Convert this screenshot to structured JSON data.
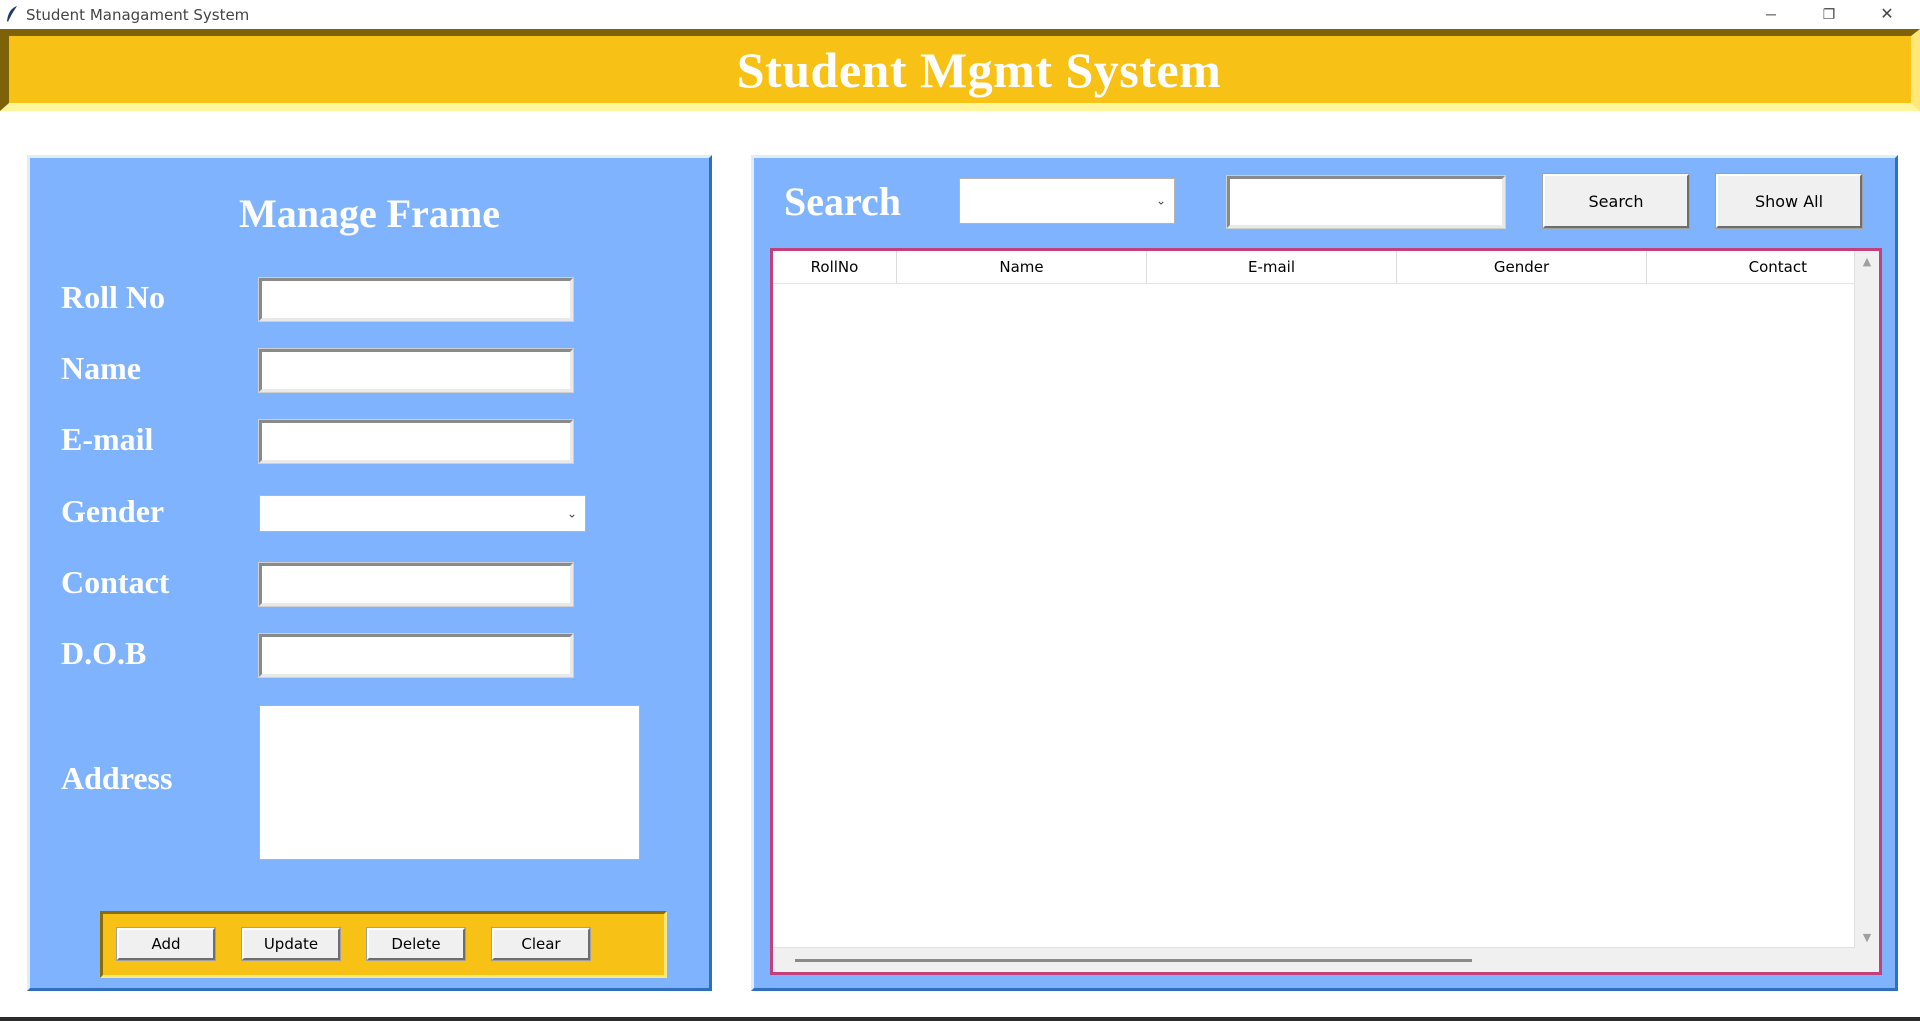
{
  "window": {
    "title": "Student Managament System",
    "controls": {
      "minimize": "─",
      "restore": "❐",
      "close": "✕"
    }
  },
  "header": {
    "title": "Student Mgmt System"
  },
  "manage": {
    "title": "Manage Frame",
    "fields": {
      "roll": {
        "label": "Roll No",
        "value": ""
      },
      "name": {
        "label": "Name",
        "value": ""
      },
      "email": {
        "label": "E-mail",
        "value": ""
      },
      "gender": {
        "label": "Gender",
        "value": ""
      },
      "contact": {
        "label": "Contact",
        "value": ""
      },
      "dob": {
        "label": "D.O.B",
        "value": ""
      },
      "address": {
        "label": "Address",
        "value": ""
      }
    },
    "buttons": {
      "add": "Add",
      "update": "Update",
      "delete": "Delete",
      "clear": "Clear"
    }
  },
  "detail": {
    "search_label": "Search",
    "search_by": "",
    "search_text": "",
    "buttons": {
      "search": "Search",
      "show_all": "Show All"
    },
    "table": {
      "columns": [
        "RollNo",
        "Name",
        "E-mail",
        "Gender",
        "Contact"
      ],
      "rows": []
    }
  },
  "colors": {
    "header_bg": "#f8c116",
    "panel_bg": "#80b3fe",
    "table_border": "#c2417d"
  },
  "icons": [
    "app-feather-icon",
    "minimize-icon",
    "restore-icon",
    "close-icon",
    "chevron-down-icon",
    "scroll-up-icon",
    "scroll-down-icon"
  ]
}
